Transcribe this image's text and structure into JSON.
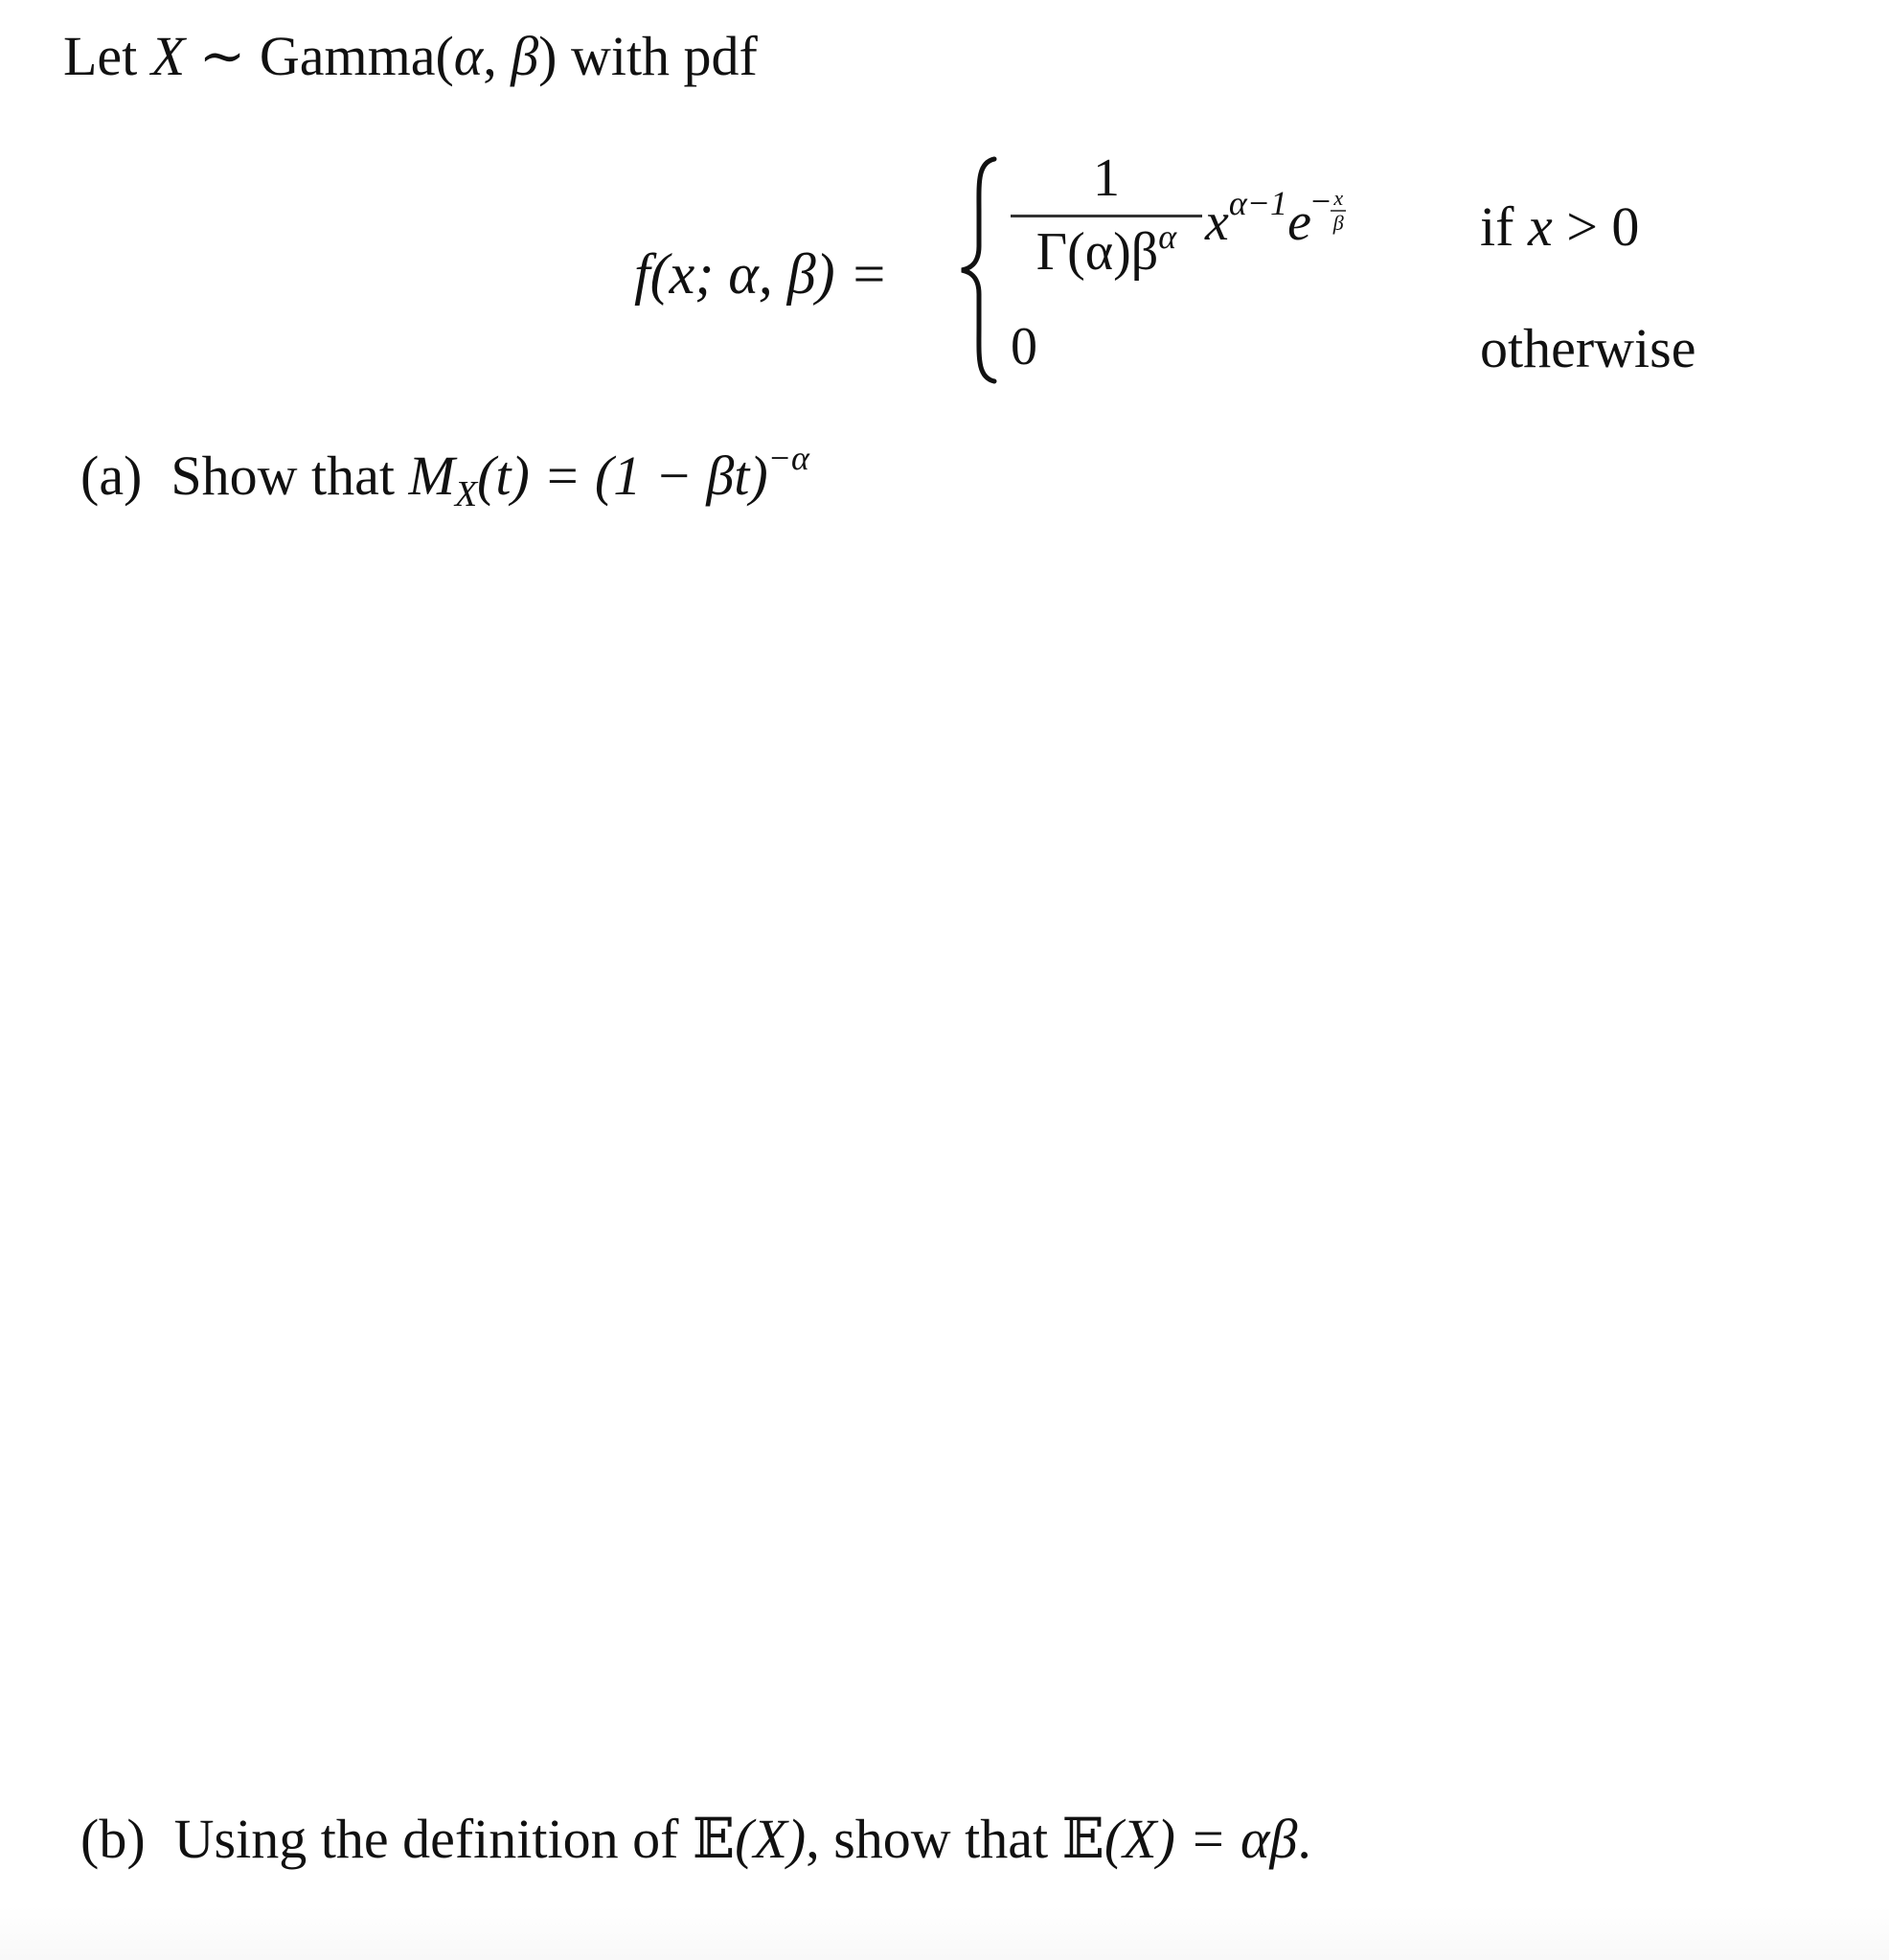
{
  "intro": {
    "prefix": "Let ",
    "var": "X",
    "tilde": " ∼ ",
    "dist": "Gamma(",
    "alpha": "α",
    "comma": ", ",
    "beta": "β",
    "close": ")",
    "suffix": " with pdf"
  },
  "pdf": {
    "lhs": "f(x; α, β) =",
    "case1": {
      "numerator": "1",
      "denominator_gamma": "Γ(α)β",
      "denominator_exp": "α",
      "x": "x",
      "x_exp": "α−1",
      "e": "e",
      "e_exp_sign": "−",
      "e_exp_num": "x",
      "e_exp_den": "β",
      "condition_word": "if ",
      "condition_var": "x",
      "condition_rest": " > 0"
    },
    "case2": {
      "value": "0",
      "condition": "otherwise"
    }
  },
  "part_a": {
    "label": "(a)",
    "text": "Show that ",
    "M": "M",
    "M_sub": "X",
    "arg": "(t) = (1 − βt)",
    "exp": "−α"
  },
  "part_b": {
    "label": "(b)",
    "text1": "Using the definition of ",
    "E1": "𝔼",
    "arg1": "(X)",
    "text2": ", show that ",
    "E2": "𝔼",
    "arg2": "(X) = αβ",
    "end": "."
  }
}
